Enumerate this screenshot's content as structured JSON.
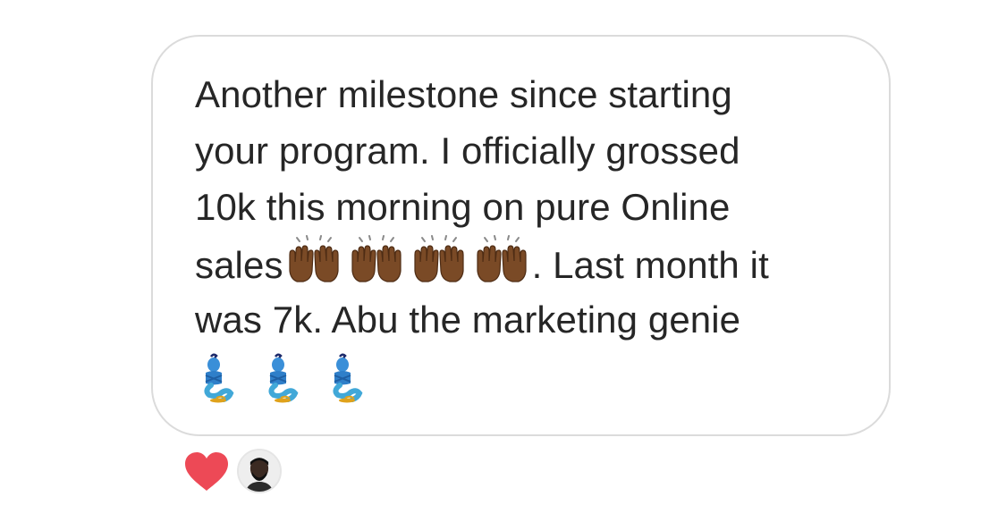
{
  "message": {
    "lines": [
      "Another milestone since starting",
      "your program. I officially grossed",
      "10k this morning on pure Online"
    ],
    "line4_before": "sales",
    "line4_after": ". Last month it",
    "line5": "was 7k. Abu the marketing genie",
    "hands_emoji_count": 4,
    "hands_emoji": "raising-hands-emoji-dark-skin",
    "genie_emoji_count": 3,
    "genie_emoji": "genie-emoji"
  },
  "reactions": {
    "heart": "heart-icon",
    "heart_color": "#ed4956",
    "reactor_avatar": "avatar"
  },
  "colors": {
    "text": "#262626",
    "bubble_border": "#dbdbdb",
    "background": "#ffffff"
  }
}
